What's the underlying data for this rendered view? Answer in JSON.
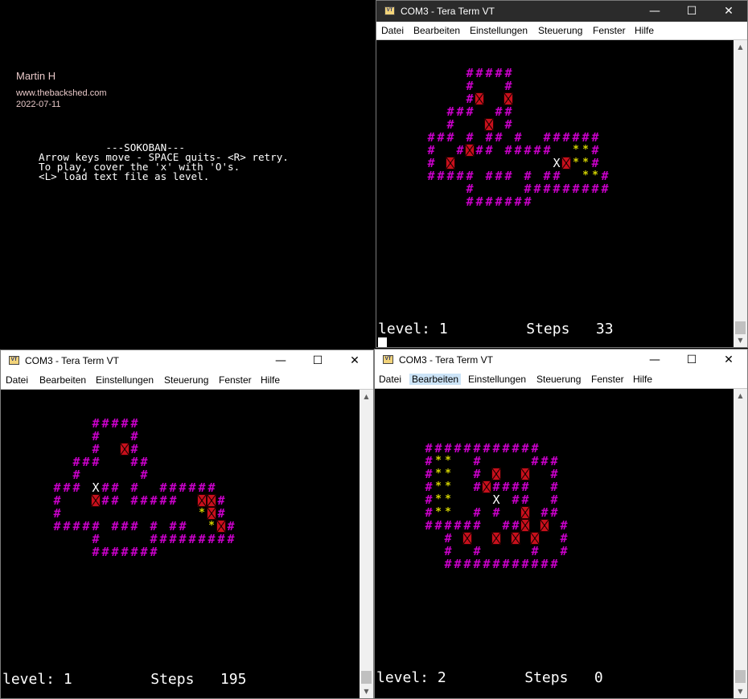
{
  "intro": {
    "author": "Martin H",
    "site": "www.thebackshed.com",
    "date": "2022-07-11",
    "title_line": "           ---SOKOBAN---",
    "line1": "Arrow keys move - SPACE quits- <R> retry.",
    "line2": "To play, cover the 'x' with 'O's.",
    "line3": "<L> load text file as level."
  },
  "common": {
    "window_title": "COM3 - Tera Term VT",
    "icon_label": "VT",
    "menu": [
      "Datei",
      "Bearbeiten",
      "Einstellungen",
      "Steuerung",
      "Fenster",
      "Hilfe"
    ],
    "btn_min": "—",
    "btn_max": "☐",
    "btn_close": "✕",
    "scroll_up": "▲",
    "scroll_down": "▼"
  },
  "windows": [
    {
      "id": "top-right",
      "status": "level: 1         Steps   33",
      "maze": [
        "    #####",
        "    #   #",
        "    #O  O",
        "  ###  ##",
        "  #   O #",
        "### # ## #  ######",
        "#  #O## #####  **#",
        "# O          XO**#",
        "##### ### # ##  **#",
        "    #     #########",
        "    #######"
      ]
    },
    {
      "id": "bottom-left",
      "status": "level: 1         Steps   195",
      "maze": [
        "    #####",
        "    #   #",
        "    #  O#",
        "  ###   ##",
        "  #      #",
        "### X## #  ######",
        "#   O## #####  OO#",
        "#              *O#",
        "##### ### # ##  *O#",
        "    #     #########",
        "    #######"
      ]
    },
    {
      "id": "bottom-right",
      "status": "level: 2         Steps   0",
      "maze": [
        "  ############",
        "  #**  #     ###",
        "  #**  # O  O  #",
        "  #**  #O####  #",
        "  #**    X ##  #",
        "  #**  # #  O ##",
        "  ######  ##O O #",
        "    # O  O O O  #",
        "    #  #     #  #",
        "    ############"
      ]
    }
  ]
}
